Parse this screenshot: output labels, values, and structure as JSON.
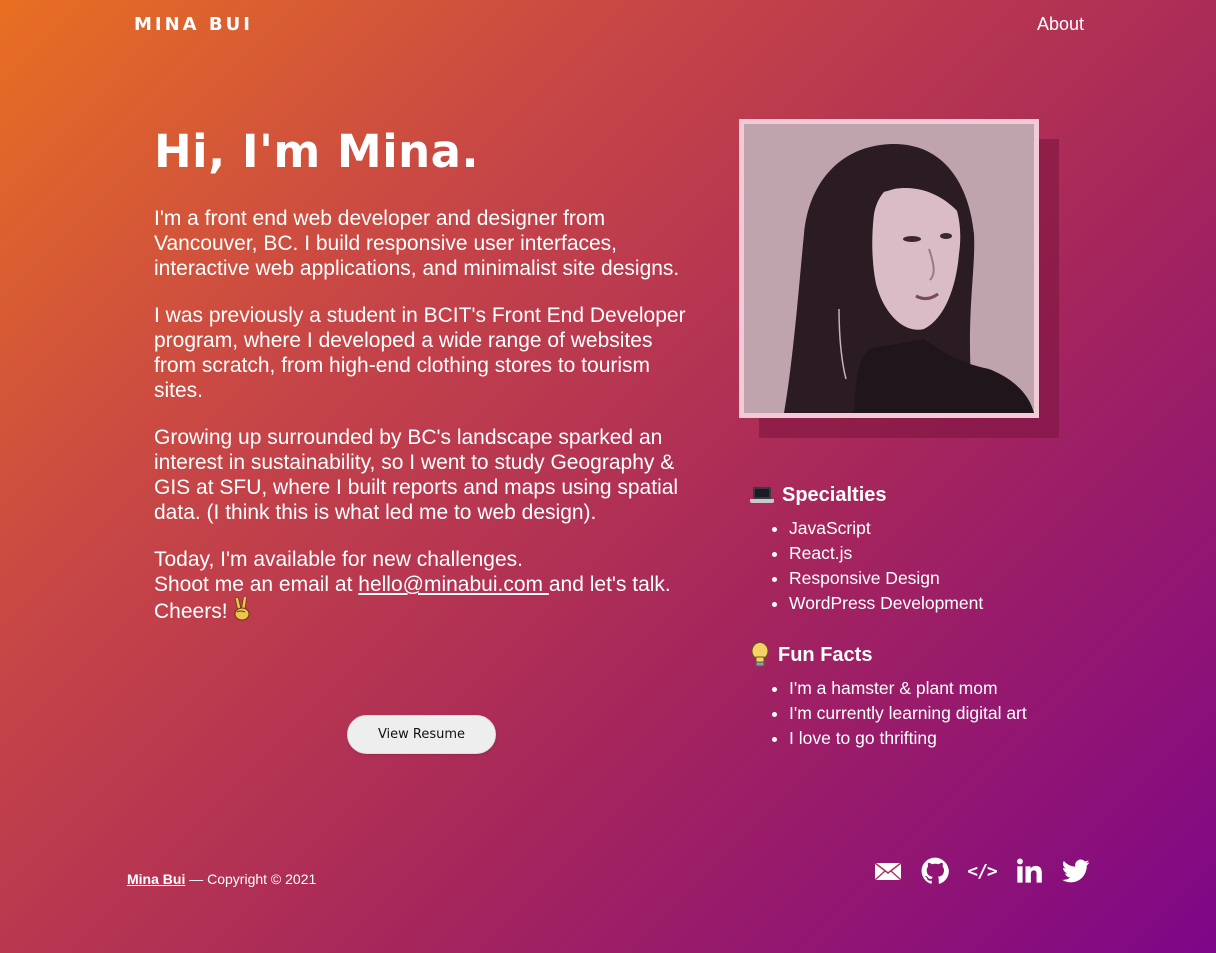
{
  "header": {
    "logo": "MINA BUI",
    "nav_about": "About"
  },
  "intro": {
    "headline": "Hi, I'm Mina.",
    "paragraph1": "I'm a front end web developer and designer from Vancouver, BC. I build responsive user interfaces, interactive web applications, and minimalist site designs.",
    "paragraph2": "I was previously a student in BCIT's Front End Developer program, where I developed a wide range of websites from scratch, from high-end clothing stores to tourism sites.",
    "paragraph3": "Growing up surrounded by BC's landscape sparked an interest in sustainability, so I went to study Geography & GIS at SFU, where I built reports and maps using spatial data. (I think this is what led me to web design).",
    "paragraph4_line1": "Today, I'm available for new challenges.",
    "paragraph4_pre": "Shoot me an email at ",
    "email": "hello@minabui.com ",
    "paragraph4_post": " and let's talk. Cheers! ",
    "resume_button": "View Resume"
  },
  "photo": {
    "icon": "portrait-photo",
    "frame_color": "#f2cbd6"
  },
  "specialties": {
    "title": "Specialties",
    "icon": "laptop-icon",
    "items": [
      "JavaScript",
      "React.js",
      "Responsive Design",
      "WordPress Development"
    ]
  },
  "fun_facts": {
    "title": "Fun Facts",
    "icon": "lightbulb-icon",
    "items": [
      "I'm a hamster & plant mom",
      "I'm currently learning digital art",
      "I love to go thrifting"
    ]
  },
  "footer": {
    "name_link": "Mina Bui",
    "copyright": " — Copyright © 2021",
    "social_icons": [
      "mail-icon",
      "github-icon",
      "code-icon",
      "linkedin-icon",
      "twitter-icon"
    ],
    "code_glyph": "</>"
  },
  "colors": {
    "gradient_start": "#e86f22",
    "gradient_end": "#7e0688",
    "button_bg": "#eeeeee"
  }
}
